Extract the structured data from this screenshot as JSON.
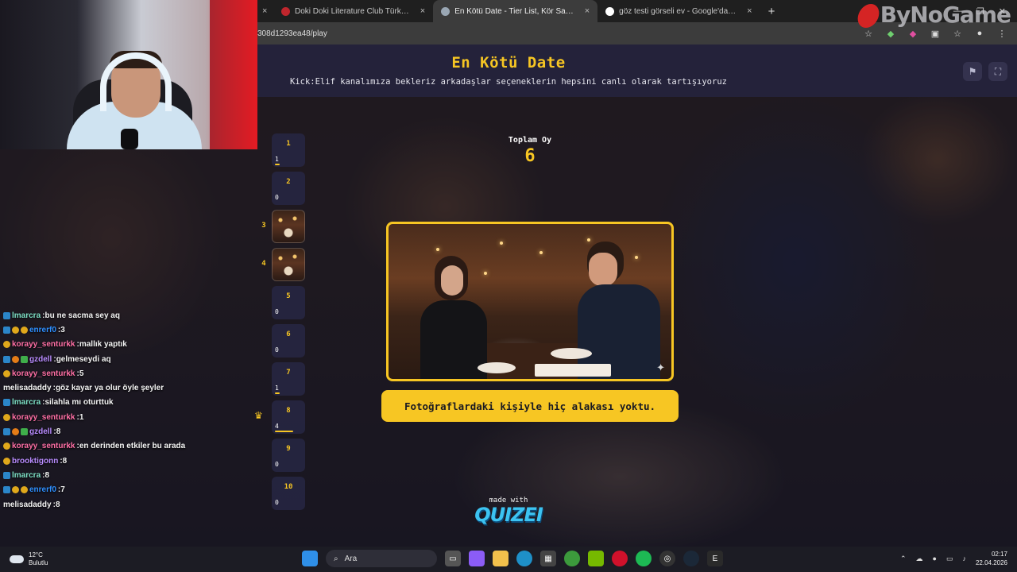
{
  "browser": {
    "tabs": [
      {
        "label": "Doki Doki Literature Club Türk…",
        "active": false,
        "favicon_color": "#c0262d"
      },
      {
        "label": "En Kötü Date - Tier List, Kör Sa…",
        "active": true,
        "favicon_color": "#9aa7b4"
      },
      {
        "label": "göz testi görseli ev - Google'da…",
        "active": false,
        "favicon_color": "#ffffff"
      }
    ],
    "close_glyph": "×",
    "new_tab_glyph": "+",
    "url": "308d1293ea48/play"
  },
  "watermark": "ByNoGame",
  "quiz": {
    "title": "En Kötü Date",
    "subtitle": "Kick:Elif kanalımıza bekleriz arkadaşlar seçeneklerin hepsini canlı olarak tartışıyoruz",
    "total_label": "Toplam Oy",
    "total_value": "6",
    "answer_text": "Fotoğraflardaki kişiyle hiç alakası yoktu.",
    "made_with": "made with",
    "brand_logo": "QUIZEI",
    "accent_color": "#f7c623",
    "options": [
      {
        "number": "1",
        "count": "1",
        "share": 0.17,
        "thumb": false,
        "side": ""
      },
      {
        "number": "2",
        "count": "0",
        "share": 0,
        "thumb": false,
        "side": ""
      },
      {
        "number": "",
        "count": "",
        "share": 0,
        "thumb": true,
        "side": "3"
      },
      {
        "number": "",
        "count": "",
        "share": 0,
        "thumb": true,
        "side": "4"
      },
      {
        "number": "5",
        "count": "0",
        "share": 0,
        "thumb": false,
        "side": ""
      },
      {
        "number": "6",
        "count": "0",
        "share": 0,
        "thumb": false,
        "side": ""
      },
      {
        "number": "7",
        "count": "1",
        "share": 0.17,
        "thumb": false,
        "side": ""
      },
      {
        "number": "8",
        "count": "4",
        "share": 0.67,
        "thumb": false,
        "side": "",
        "crown": true
      },
      {
        "number": "9",
        "count": "0",
        "share": 0,
        "thumb": false,
        "side": ""
      },
      {
        "number": "10",
        "count": "0",
        "share": 0,
        "thumb": false,
        "side": ""
      }
    ]
  },
  "chat": [
    {
      "user": "lmarcra",
      "color": "#7ee0c6",
      "text": "bu ne sacma sey aq",
      "badges": [
        "prime"
      ]
    },
    {
      "user": "enrerf0",
      "color": "#2e8fff",
      "text": "3",
      "badges": [
        "prime",
        "gold",
        "gold"
      ]
    },
    {
      "user": "korayy_senturkk",
      "color": "#ff6fa5",
      "text": "mallık yaptık",
      "badges": [
        "gold"
      ]
    },
    {
      "user": "gzdell",
      "color": "#b98cff",
      "text": "gelmeseydi aq",
      "badges": [
        "prime",
        "orange",
        "green"
      ]
    },
    {
      "user": "korayy_senturkk",
      "color": "#ff6fa5",
      "text": "5",
      "badges": [
        "gold"
      ]
    },
    {
      "user": "melisadaddy",
      "color": "#f4f4f4",
      "text": "göz kayar ya olur öyle şeyler",
      "badges": []
    },
    {
      "user": "lmarcra",
      "color": "#7ee0c6",
      "text": "silahla mı oturttuk",
      "badges": [
        "prime"
      ]
    },
    {
      "user": "korayy_senturkk",
      "color": "#ff6fa5",
      "text": "1",
      "badges": [
        "gold"
      ]
    },
    {
      "user": "gzdell",
      "color": "#b98cff",
      "text": "8",
      "badges": [
        "prime",
        "orange",
        "green"
      ]
    },
    {
      "user": "korayy_senturkk",
      "color": "#ff6fa5",
      "text": "en derinden etkiler bu arada",
      "badges": [
        "gold"
      ]
    },
    {
      "user": "brooktigonn",
      "color": "#b98cff",
      "text": "8",
      "badges": [
        "gold"
      ]
    },
    {
      "user": "lmarcra",
      "color": "#7ee0c6",
      "text": "8",
      "badges": [
        "prime"
      ]
    },
    {
      "user": "enrerf0",
      "color": "#2e8fff",
      "text": "7",
      "badges": [
        "prime",
        "gold",
        "gold"
      ]
    },
    {
      "user": "melisadaddy",
      "color": "#f4f4f4",
      "text": "8",
      "badges": []
    }
  ],
  "taskbar": {
    "temperature": "12°C",
    "weather_desc": "Bulutlu",
    "search_placeholder": "Ara",
    "time": "02:17",
    "date": "22.04.2026"
  }
}
